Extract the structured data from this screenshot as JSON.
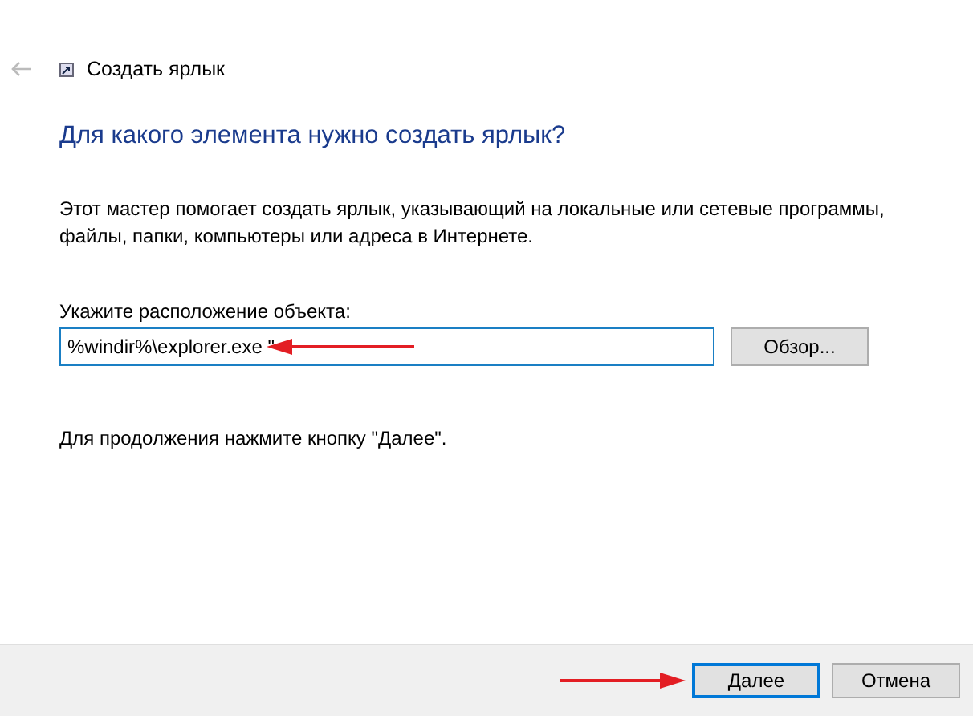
{
  "window": {
    "title": "Создать ярлык",
    "back_enabled": false
  },
  "heading": "Для какого элемента нужно создать ярлык?",
  "description": "Этот мастер помогает создать ярлык, указывающий на локальные или сетевые программы, файлы, папки, компьютеры или адреса в Интернете.",
  "location": {
    "label": "Укажите расположение объекта:",
    "value": "%windir%\\explorer.exe \"",
    "pointer_arrow": true
  },
  "browse_button": "Обзор...",
  "hint": "Для продолжения нажмите кнопку \"Далее\".",
  "buttons": [
    {
      "label": "Далее",
      "default": true,
      "pointer_arrow": true
    },
    {
      "label": "Отмена",
      "default": false,
      "pointer_arrow": false
    }
  ]
}
